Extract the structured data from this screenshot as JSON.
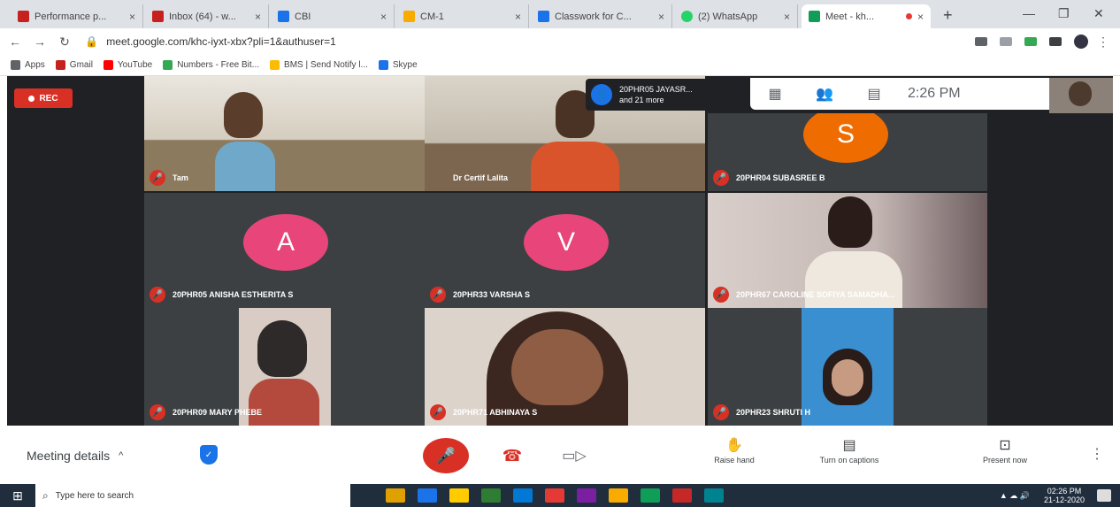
{
  "browser": {
    "tabs": [
      {
        "title": "Performance p...",
        "color": "#c5221f"
      },
      {
        "title": "Inbox (64) - w...",
        "color": "#c5221f"
      },
      {
        "title": "CBI",
        "color": "#1a73e8"
      },
      {
        "title": "CM-1",
        "color": "#f9ab00"
      },
      {
        "title": "Classwork for C...",
        "color": "#1a73e8"
      },
      {
        "title": "(2) WhatsApp",
        "color": "#25d366"
      },
      {
        "title": "Meet - kh...",
        "color": "#0f9d58",
        "active": true
      }
    ],
    "new_tab": "+",
    "url": "meet.google.com/khc-iyxt-xbx?pli=1&authuser=1",
    "bookmarks": [
      {
        "label": "Apps",
        "color": "#5f6368"
      },
      {
        "label": "Gmail",
        "color": "#c5221f"
      },
      {
        "label": "YouTube",
        "color": "#ff0000"
      },
      {
        "label": "Numbers - Free Bit...",
        "color": "#34a853"
      },
      {
        "label": "BMS | Send Notify l...",
        "color": "#fbbc04"
      },
      {
        "label": "Skype",
        "color": "#1a73e8"
      }
    ]
  },
  "meet": {
    "rec_label": "REC",
    "presenter_chip": {
      "name": "20PHR05 JAYASR...",
      "more": "and 21 more"
    },
    "time": "2:26 PM",
    "tiles": [
      {
        "name": "Tam",
        "kind": "video",
        "bg": "#8c7a5e"
      },
      {
        "name": "Dr Certif Lalita",
        "kind": "video",
        "bg": "#7d6650"
      },
      {
        "name": "20PHR04 SUBASREE B",
        "kind": "avatar",
        "letter": "S",
        "avatar_color": "#ef6c00"
      },
      {
        "name": "20PHR05 ANISHA ESTHERITA S",
        "kind": "avatar",
        "letter": "A",
        "avatar_color": "#e8467a"
      },
      {
        "name": "20PHR33 VARSHA S",
        "kind": "avatar",
        "letter": "V",
        "avatar_color": "#e8467a"
      },
      {
        "name": "20PHR67 CAROLINE SOFIYA SAMADHA...",
        "kind": "video",
        "bg": "#6e5e60"
      },
      {
        "name": "20PHR09 MARY PHEBE",
        "kind": "video",
        "bg": "#2d2a29"
      },
      {
        "name": "20PHR71 ABHINAYA S",
        "kind": "video",
        "bg": "#b7a69a"
      },
      {
        "name": "20PHR23 SHRUTI H",
        "kind": "video",
        "bg": "#3a8fd0"
      }
    ],
    "bottom": {
      "meeting_details": "Meeting details",
      "raise_hand": "Raise hand",
      "captions": "Turn on captions",
      "present": "Present now"
    }
  },
  "taskbar": {
    "search_placeholder": "Type here to search",
    "clock_time": "02:26 PM",
    "clock_date": "21-12-2020",
    "apps": [
      "#e0a100",
      "#1a73e8",
      "#ffcc00",
      "#2e7d32",
      "#0078d4",
      "#e53935",
      "#7b1fa2",
      "#f9ab00",
      "#0f9d58",
      "#c62828",
      "#00838f"
    ]
  }
}
